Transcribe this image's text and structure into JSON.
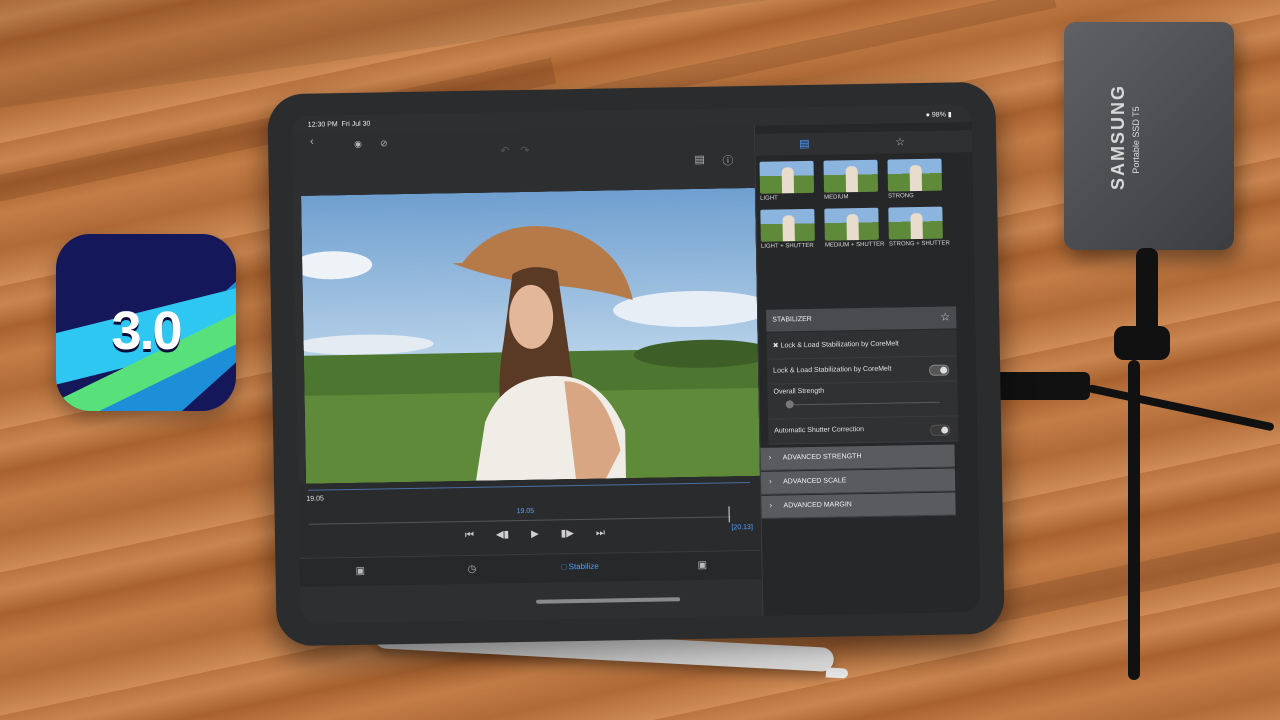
{
  "app_icon": {
    "version_label": "3.0"
  },
  "ssd": {
    "brand": "SAMSUNG",
    "model": "Portable SSD T5"
  },
  "status_bar": {
    "time": "12:30 PM",
    "date": "Fri Jul 30",
    "battery": "98%"
  },
  "timeline": {
    "start_time": "19.05",
    "current_time": "19.05",
    "end_time": "[20.13]"
  },
  "bottom_bar": {
    "active_tab_label": "Stabilize"
  },
  "presets": [
    {
      "label": "LIGHT"
    },
    {
      "label": "MEDIUM"
    },
    {
      "label": "STRONG"
    },
    {
      "label": "LIGHT + SHUTTER"
    },
    {
      "label": "MEDIUM + SHUTTER"
    },
    {
      "label": "STRONG + SHUTTER"
    }
  ],
  "stabilizer": {
    "header": "STABILIZER",
    "plugin_label": "Lock & Load Stabilization by CoreMelt",
    "toggle_label": "Lock & Load Stabilization by CoreMelt",
    "strength_label": "Overall Strength",
    "shutter_label": "Automatic Shutter Correction"
  },
  "accordion": [
    {
      "label": "ADVANCED STRENGTH"
    },
    {
      "label": "ADVANCED SCALE"
    },
    {
      "label": "ADVANCED MARGIN"
    }
  ],
  "colors": {
    "accent": "#4d9fff",
    "panel": "#262729",
    "wood": "#b8733f"
  }
}
